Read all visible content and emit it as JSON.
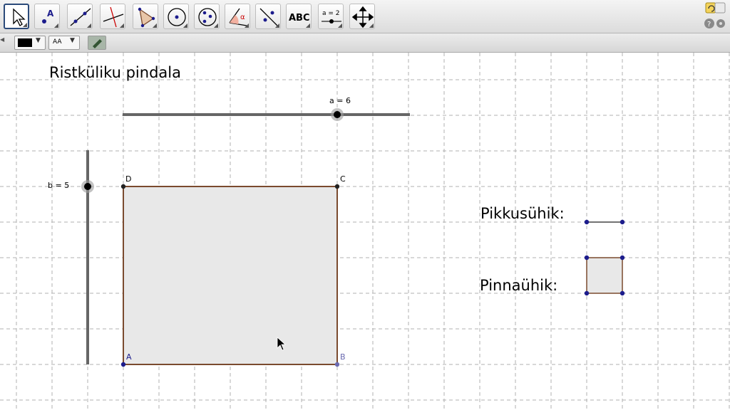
{
  "toolbar": {
    "tools": [
      {
        "name": "move-tool",
        "selected": true
      },
      {
        "name": "point-tool",
        "text": "A"
      },
      {
        "name": "line-tool"
      },
      {
        "name": "perpendicular-line-tool"
      },
      {
        "name": "polygon-tool"
      },
      {
        "name": "circle-tool"
      },
      {
        "name": "conic-tool"
      },
      {
        "name": "angle-tool",
        "text": "α"
      },
      {
        "name": "reflect-tool"
      },
      {
        "name": "text-tool",
        "text": "ABC"
      },
      {
        "name": "slider-tool",
        "text": "a = 2"
      },
      {
        "name": "move-graphics-view-tool"
      }
    ]
  },
  "stylebar": {
    "color_value": "#000000",
    "text_size_label": "AA"
  },
  "canvas": {
    "title": "Ristküliku pindala",
    "slider_a_label": "a = 6",
    "slider_b_label": "b = 5",
    "slider_a_value": 6,
    "slider_b_value": 5,
    "points": {
      "A": "A",
      "B": "B",
      "C": "C",
      "D": "D"
    },
    "length_unit_label": "Pikkusühik:",
    "area_unit_label": "Pinnaühik:"
  },
  "colors": {
    "polygon_fill": "#e8e8e8",
    "polygon_stroke": "#7a4a2e",
    "point_color": "#1c1c8c",
    "grid": "#b0b0b0",
    "slider": "#666666"
  }
}
